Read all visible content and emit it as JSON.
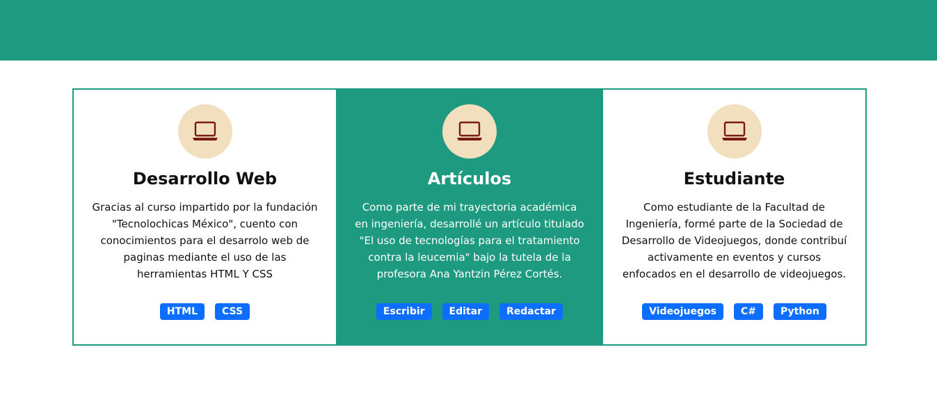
{
  "colors": {
    "accent": "#1e9a80",
    "icon_bg": "#f1dfbd",
    "icon": "#7a1a14",
    "tag_bg": "#0d6efd"
  },
  "cards": [
    {
      "icon": "laptop-icon",
      "title": "Desarrollo Web",
      "description": "Gracias al curso impartido por la fundación \"Tecnolochicas México\", cuento con conocimientos para el desarrolo web de paginas mediante el uso de las herramientas HTML Y CSS",
      "tags": [
        "HTML",
        "CSS"
      ]
    },
    {
      "icon": "laptop-icon",
      "title": "Artículos",
      "description": "Como parte de mi trayectoria académica en ingeniería, desarrollé un artículo titulado \"El uso de tecnologías para el tratamiento contra la leucemia\" bajo la tutela de la profesora Ana Yantzin Pérez Cortés.",
      "tags": [
        "Escribir",
        "Editar",
        "Redactar"
      ]
    },
    {
      "icon": "laptop-icon",
      "title": "Estudiante",
      "description": "Como estudiante de la Facultad de Ingeniería, formé parte de la Sociedad de Desarrollo de Videojuegos, donde contribuí activamente en eventos y cursos enfocados en el desarrollo de videojuegos.",
      "tags": [
        "Videojuegos",
        "C#",
        "Python"
      ]
    }
  ]
}
